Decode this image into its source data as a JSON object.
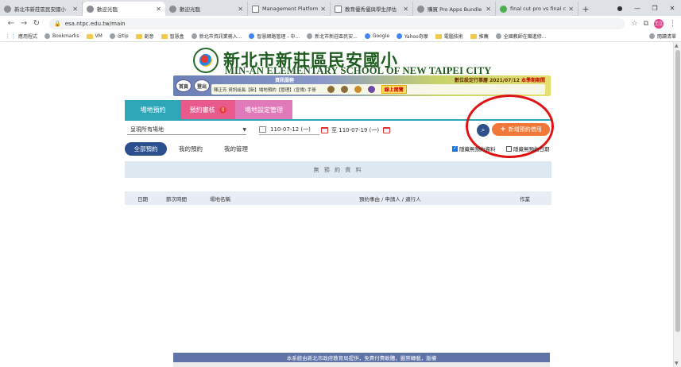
{
  "browser": {
    "tabs": [
      {
        "title": "新北市新莊區民安國小",
        "active": false
      },
      {
        "title": "歡迎光臨",
        "active": true
      },
      {
        "title": "歡迎光臨",
        "active": false
      },
      {
        "title": "Management Platform",
        "active": false
      },
      {
        "title": "教育優秀優與學生評估",
        "active": false
      },
      {
        "title": "購買 Pro Apps Bundle",
        "active": false
      },
      {
        "title": "final cut pro vs final c",
        "active": false
      }
    ],
    "url": "esa.ntpc.edu.tw/main",
    "profile_initials": "王立",
    "bookmarks": [
      "應用程式",
      "Bookmarks",
      "VM",
      "@tip",
      "創意",
      "智慧盒",
      "新北市資訊業務入...",
      "智慧網路管理 - 中...",
      "新北市新莊區民安...",
      "Google",
      "Yahoo奇摩",
      "電腦技術",
      "推薦",
      "全國教師在職進修..."
    ],
    "reading_list": "閱讀清單"
  },
  "school": {
    "name_cn": "新北市新莊區民安國小",
    "name_en": "MIN-AN ELEMENTARY SCHOOL OF NEW TAIPEI CITY"
  },
  "banner": {
    "home_label": "首頁",
    "logout_label": "登出",
    "service_label": "資訊服務",
    "date_info_prefix": "數位設定行事曆 2021/07/12",
    "date_info_highlight": "本學期期間",
    "user_info": "陳正芳 資訊組長【新】場地預約【管理】(宣傳) 手冊",
    "online_label": "線上閱覽"
  },
  "tabs": {
    "venue_booking": "場地預約",
    "booking_review": "預約審核",
    "review_count": "0",
    "venue_settings": "場地設定管理"
  },
  "filters": {
    "venue_select": "呈現所有場地",
    "date_from": "110-07-12 (一)",
    "to_label": "至",
    "date_to": "110-07-19 (一)",
    "add_button": "新增預約借用"
  },
  "subtabs": {
    "all": "全部預約",
    "mine": "我的預約",
    "manage": "我的管理"
  },
  "checkboxes": {
    "hide_no_booking": "隱藏無預約資料",
    "hide_no_booking_checked": true,
    "hide_no_booking_days": "隱藏無預約日期",
    "hide_no_booking_days_checked": false
  },
  "table": {
    "empty_message": "無 預 約 資 料",
    "headers": [
      "日期",
      "節次時間",
      "場地名稱",
      "預約事由 / 申請人 / 適行人",
      "作業"
    ]
  },
  "footer": {
    "text": "本系統由新北市政府教育局提供，免費付費軟體，嚴禁轉載，版權"
  }
}
